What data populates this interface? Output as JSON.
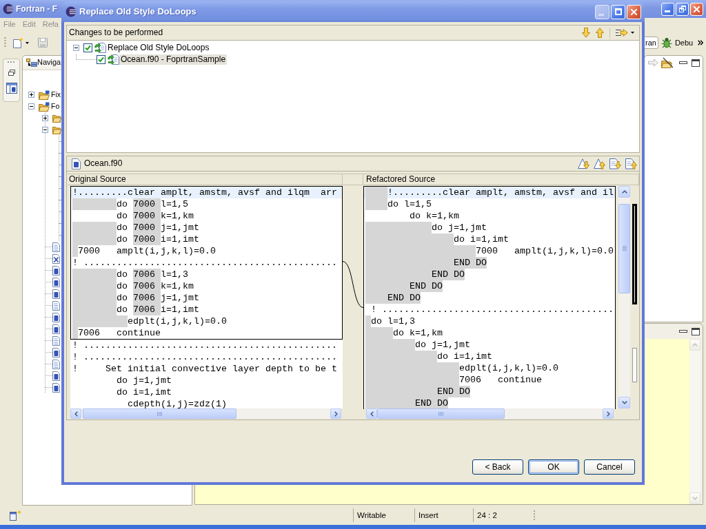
{
  "window": {
    "title": "Fortran - F"
  },
  "menu": [
    {
      "label": "File"
    },
    {
      "label": "Edit"
    },
    {
      "label": "Refa"
    }
  ],
  "perspectives": [
    {
      "label": "ran",
      "selected": true
    },
    {
      "label": "Debu",
      "selected": false
    }
  ],
  "navigator": {
    "tab": "Naviga",
    "tree": [
      {
        "kind": "project",
        "label": "Fix",
        "expanded": false
      },
      {
        "kind": "project",
        "label": "Fo",
        "expanded": true,
        "children": [
          {
            "kind": "folder",
            "expanded": false
          },
          {
            "kind": "folder",
            "expanded": true
          },
          {
            "kind": "text"
          },
          {
            "kind": "xml"
          },
          {
            "kind": "fortran"
          },
          {
            "kind": "fortran"
          },
          {
            "kind": "fortran"
          },
          {
            "kind": "text"
          },
          {
            "kind": "fortran"
          },
          {
            "kind": "fortran"
          },
          {
            "kind": "text"
          },
          {
            "kind": "fortran"
          },
          {
            "kind": "text"
          },
          {
            "kind": "fortran"
          },
          {
            "kind": "fortran"
          }
        ]
      }
    ]
  },
  "dialog": {
    "title": "Replace Old Style DoLoops",
    "title_buttons": [
      {
        "kind": "minimize",
        "disabled": true
      },
      {
        "kind": "maximize",
        "disabled": false
      },
      {
        "kind": "close",
        "disabled": false
      }
    ],
    "changes": {
      "title": "Changes to be performed",
      "tree": [
        {
          "label": "Replace Old Style DoLoops",
          "checked": true,
          "expanded": true,
          "selected": false,
          "children": [
            {
              "label": "Ocean.f90 - FoprtranSample",
              "checked": true,
              "selected": true
            }
          ]
        }
      ]
    },
    "compare": {
      "file": "Ocean.f90",
      "panes": [
        {
          "title": "Original Source",
          "lines": [
            {
              "current": true,
              "in_change": true,
              "segments": [
                {
                  "text": "!.........clear amplt, amstm, avsf and ilqm  arr",
                  "changed": false
                }
              ]
            },
            {
              "current": false,
              "in_change": true,
              "indent_changed": true,
              "segments": [
                {
                  "text": "        do ",
                  "changed": false
                },
                {
                  "text": "7000 ",
                  "changed": true
                },
                {
                  "text": "l=1,5",
                  "changed": false
                }
              ]
            },
            {
              "current": false,
              "in_change": true,
              "indent_changed": false,
              "segments": [
                {
                  "text": "        do ",
                  "changed": false
                },
                {
                  "text": "7000 ",
                  "changed": true
                },
                {
                  "text": "k=1,km",
                  "changed": false
                }
              ]
            },
            {
              "current": false,
              "in_change": true,
              "indent_changed": true,
              "segments": [
                {
                  "text": "        do ",
                  "changed": false
                },
                {
                  "text": "7000 ",
                  "changed": true
                },
                {
                  "text": "j=1,jmt",
                  "changed": false
                }
              ]
            },
            {
              "current": false,
              "in_change": true,
              "indent_changed": true,
              "segments": [
                {
                  "text": "        do ",
                  "changed": false
                },
                {
                  "text": "7000 ",
                  "changed": true
                },
                {
                  "text": "i=1,imt",
                  "changed": false
                }
              ]
            },
            {
              "current": false,
              "in_change": true,
              "indent_changed": true,
              "segments": [
                {
                  "text": " 7000   amplt(i,j,k,l)=0.0",
                  "changed": false
                }
              ]
            },
            {
              "current": false,
              "in_change": true,
              "segments": [
                {
                  "text": "! ..............................................",
                  "changed": false
                }
              ]
            },
            {
              "current": false,
              "in_change": true,
              "indent_changed": true,
              "segments": [
                {
                  "text": "        do ",
                  "changed": false
                },
                {
                  "text": "7006 ",
                  "changed": true
                },
                {
                  "text": "l=1,3",
                  "changed": false
                }
              ]
            },
            {
              "current": false,
              "in_change": true,
              "indent_changed": true,
              "segments": [
                {
                  "text": "        do ",
                  "changed": false
                },
                {
                  "text": "7006 ",
                  "changed": true
                },
                {
                  "text": "k=1,km",
                  "changed": false
                }
              ]
            },
            {
              "current": false,
              "in_change": true,
              "indent_changed": true,
              "segments": [
                {
                  "text": "        do ",
                  "changed": false
                },
                {
                  "text": "7006 ",
                  "changed": true
                },
                {
                  "text": "j=1,jmt",
                  "changed": false
                }
              ]
            },
            {
              "current": false,
              "in_change": true,
              "indent_changed": true,
              "segments": [
                {
                  "text": "        do ",
                  "changed": false
                },
                {
                  "text": "7006 ",
                  "changed": true
                },
                {
                  "text": "i=1,imt",
                  "changed": false
                }
              ]
            },
            {
              "current": false,
              "in_change": true,
              "indent_changed": true,
              "segments": [
                {
                  "text": "          edplt(i,j,k,l)=0.0",
                  "changed": false
                }
              ]
            },
            {
              "current": false,
              "in_change": true,
              "indent_changed": true,
              "segments": [
                {
                  "text": " 7006   continue",
                  "changed": false
                }
              ]
            },
            {
              "current": false,
              "in_change": false,
              "segments": [
                {
                  "text": "! ..............................................",
                  "changed": false
                }
              ]
            },
            {
              "current": false,
              "in_change": false,
              "segments": [
                {
                  "text": "! ..............................................",
                  "changed": false
                }
              ]
            },
            {
              "current": false,
              "in_change": false,
              "segments": [
                {
                  "text": "!     Set initial convective layer depth to be t",
                  "changed": false
                }
              ]
            },
            {
              "current": false,
              "in_change": false,
              "indent_changed": false,
              "segments": [
                {
                  "text": "        do j=1,jmt",
                  "changed": false
                }
              ]
            },
            {
              "current": false,
              "in_change": false,
              "indent_changed": false,
              "segments": [
                {
                  "text": "        do i=1,imt",
                  "changed": false
                }
              ]
            },
            {
              "current": false,
              "in_change": false,
              "indent_changed": false,
              "segments": [
                {
                  "text": "          cdepth(i,j)=zdz(1)",
                  "changed": false
                }
              ]
            }
          ]
        },
        {
          "title": "Refactored Source",
          "lines": [
            {
              "current": true,
              "in_change": true,
              "indent_changed": true,
              "segments": [
                {
                  "text": "    !.........clear amplt, amstm, avsf and il",
                  "changed": false
                }
              ]
            },
            {
              "current": false,
              "in_change": true,
              "indent_changed": true,
              "segments": [
                {
                  "text": "    do l=1,5",
                  "changed": false
                }
              ]
            },
            {
              "current": false,
              "in_change": true,
              "indent_changed": false,
              "segments": [
                {
                  "text": "        do k=1,km",
                  "changed": false
                }
              ]
            },
            {
              "current": false,
              "in_change": true,
              "indent_changed": true,
              "segments": [
                {
                  "text": "            do j=1,jmt",
                  "changed": false
                }
              ]
            },
            {
              "current": false,
              "in_change": true,
              "indent_changed": true,
              "segments": [
                {
                  "text": "                do i=1,imt",
                  "changed": false
                }
              ]
            },
            {
              "current": false,
              "in_change": true,
              "indent_changed": true,
              "segments": [
                {
                  "text": "                    7000   amplt(i,j,k,l)=0.0",
                  "changed": false
                }
              ]
            },
            {
              "current": false,
              "in_change": true,
              "indent_changed": true,
              "segments": [
                {
                  "text": "                END DO",
                  "changed": true
                }
              ]
            },
            {
              "current": false,
              "in_change": true,
              "indent_changed": true,
              "segments": [
                {
                  "text": "            END DO",
                  "changed": true
                }
              ]
            },
            {
              "current": false,
              "in_change": true,
              "indent_changed": true,
              "segments": [
                {
                  "text": "        END DO",
                  "changed": true
                }
              ]
            },
            {
              "current": false,
              "in_change": true,
              "indent_changed": true,
              "segments": [
                {
                  "text": "    END DO",
                  "changed": true
                }
              ]
            },
            {
              "current": false,
              "in_change": true,
              "indent_changed": false,
              "segments": [
                {
                  "text": " ! ..........................................",
                  "changed": false
                }
              ]
            },
            {
              "current": false,
              "in_change": true,
              "indent_changed": true,
              "segments": [
                {
                  "text": " do l=1,3",
                  "changed": false
                }
              ]
            },
            {
              "current": false,
              "in_change": true,
              "indent_changed": true,
              "segments": [
                {
                  "text": "     do k=1,km",
                  "changed": false
                }
              ]
            },
            {
              "current": false,
              "in_change": true,
              "indent_changed": true,
              "segments": [
                {
                  "text": "         do j=1,jmt",
                  "changed": false
                }
              ]
            },
            {
              "current": false,
              "in_change": true,
              "indent_changed": true,
              "segments": [
                {
                  "text": "             do i=1,imt",
                  "changed": false
                }
              ]
            },
            {
              "current": false,
              "in_change": true,
              "indent_changed": true,
              "segments": [
                {
                  "text": "                 edplt(i,j,k,l)=0.0",
                  "changed": false
                }
              ]
            },
            {
              "current": false,
              "in_change": true,
              "indent_changed": true,
              "segments": [
                {
                  "text": "                 7006   continue",
                  "changed": false
                }
              ]
            },
            {
              "current": false,
              "in_change": true,
              "indent_changed": true,
              "segments": [
                {
                  "text": "             END DO",
                  "changed": true
                }
              ]
            },
            {
              "current": false,
              "in_change": true,
              "indent_changed": true,
              "segments": [
                {
                  "text": "         END DO",
                  "changed": true
                }
              ]
            }
          ]
        }
      ]
    },
    "buttons": [
      {
        "label": "< Back",
        "default": false
      },
      {
        "label": "OK",
        "default": true
      },
      {
        "label": "Cancel",
        "default": false
      }
    ]
  },
  "status_bar": {
    "fields": [
      "Writable",
      "Insert",
      "24 : 2"
    ]
  }
}
